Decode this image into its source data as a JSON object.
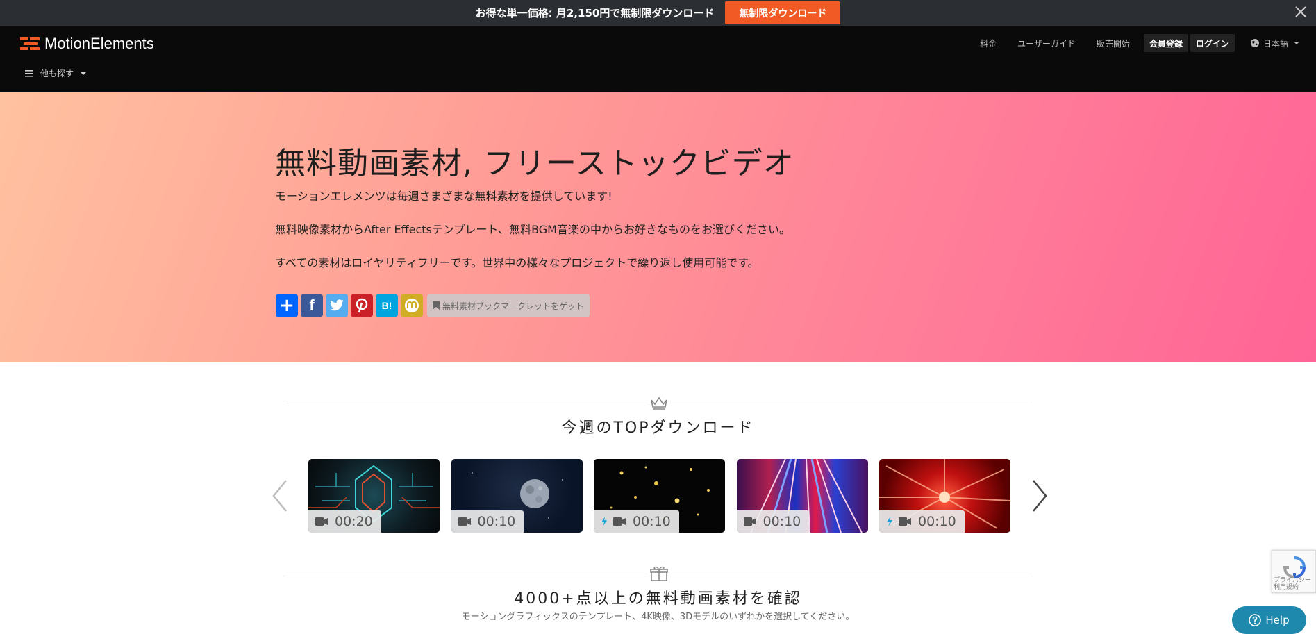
{
  "promo": {
    "text": "お得な単一価格: 月2,150円で無制限ダウンロード",
    "button_label": "無制限ダウンロード",
    "close_icon": "close-icon"
  },
  "header": {
    "logo_text": "MotionElements",
    "browse_label": "他も探す",
    "nav": {
      "pricing": "料金",
      "user_guide": "ユーザーガイド",
      "sell": "販売開始",
      "signup": "会員登録",
      "login": "ログイン",
      "language": "日本語"
    }
  },
  "hero": {
    "title": "無料動画素材, フリーストックビデオ",
    "p1": "モーションエレメンツは毎週さまざまな無料素材を提供しています!",
    "p2": "無料映像素材からAfter Effectsテンプレート、無料BGM音楽の中からお好きなものをお選びください。",
    "p3": "すべての素材はロイヤリティフリーです。世界中の様々なプロジェクトで繰り返し使用可能です。",
    "share": {
      "add": "+",
      "facebook": "f",
      "hatena": "B!",
      "bookmarklet_label": "無料素材ブックマークレットをゲット"
    }
  },
  "top_downloads": {
    "title": "今週のTOPダウンロード",
    "items": [
      {
        "duration": "00:20",
        "type": "video"
      },
      {
        "duration": "00:10",
        "type": "video"
      },
      {
        "duration": "00:10",
        "type": "ae-template"
      },
      {
        "duration": "00:10",
        "type": "video"
      },
      {
        "duration": "00:10",
        "type": "ae-template"
      }
    ]
  },
  "free_section": {
    "title": "4000+点以上の無料動画素材を確認",
    "subtitle": "モーショングラフィックスのテンプレート、4K映像、3Dモデルのいずれかを選択してください。"
  },
  "recaptcha": {
    "text1": "プライバシー",
    "text2": "利用規約"
  },
  "help": {
    "label": "Help"
  },
  "colors": {
    "accent": "#f15a24",
    "header_bg": "#0a0a0a",
    "promo_bg": "#2b2e33",
    "help_bg": "#1e89ad"
  }
}
